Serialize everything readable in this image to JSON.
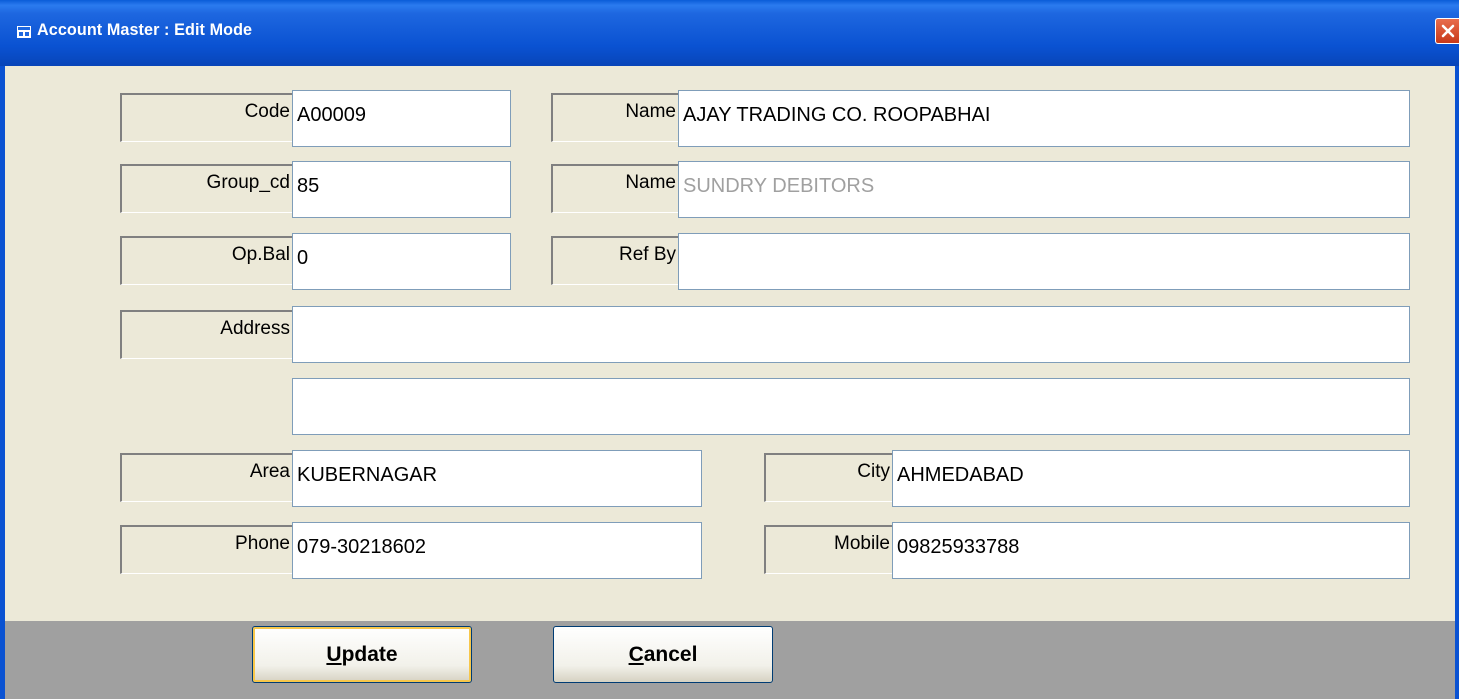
{
  "window": {
    "title": "Account Master : Edit Mode"
  },
  "form": {
    "code": {
      "label": "Code",
      "value": "A00009"
    },
    "name": {
      "label": "Name",
      "value": "AJAY TRADING CO.  ROOPABHAI"
    },
    "group_cd": {
      "label": "Group_cd",
      "value": "85"
    },
    "group_name": {
      "label": "Name",
      "value": "SUNDRY DEBITORS"
    },
    "op_bal": {
      "label": "Op.Bal",
      "value": "0"
    },
    "ref_by": {
      "label": "Ref By",
      "value": ""
    },
    "address": {
      "label": "Address",
      "line1": "",
      "line2": ""
    },
    "area": {
      "label": "Area",
      "value": "KUBERNAGAR"
    },
    "city": {
      "label": "City",
      "value": "AHMEDABAD"
    },
    "phone": {
      "label": "Phone",
      "value": "079-30218602"
    },
    "mobile": {
      "label": "Mobile",
      "value": "09825933788"
    }
  },
  "buttons": {
    "update": {
      "accel": "U",
      "rest": "pdate"
    },
    "cancel": {
      "accel": "C",
      "rest": "ancel"
    }
  },
  "colors": {
    "titlebar": "#0A52D2",
    "window_bg": "#ECE9D8",
    "bottom_bar": "#A0A0A0",
    "muted_text": "#A0A0A0"
  }
}
